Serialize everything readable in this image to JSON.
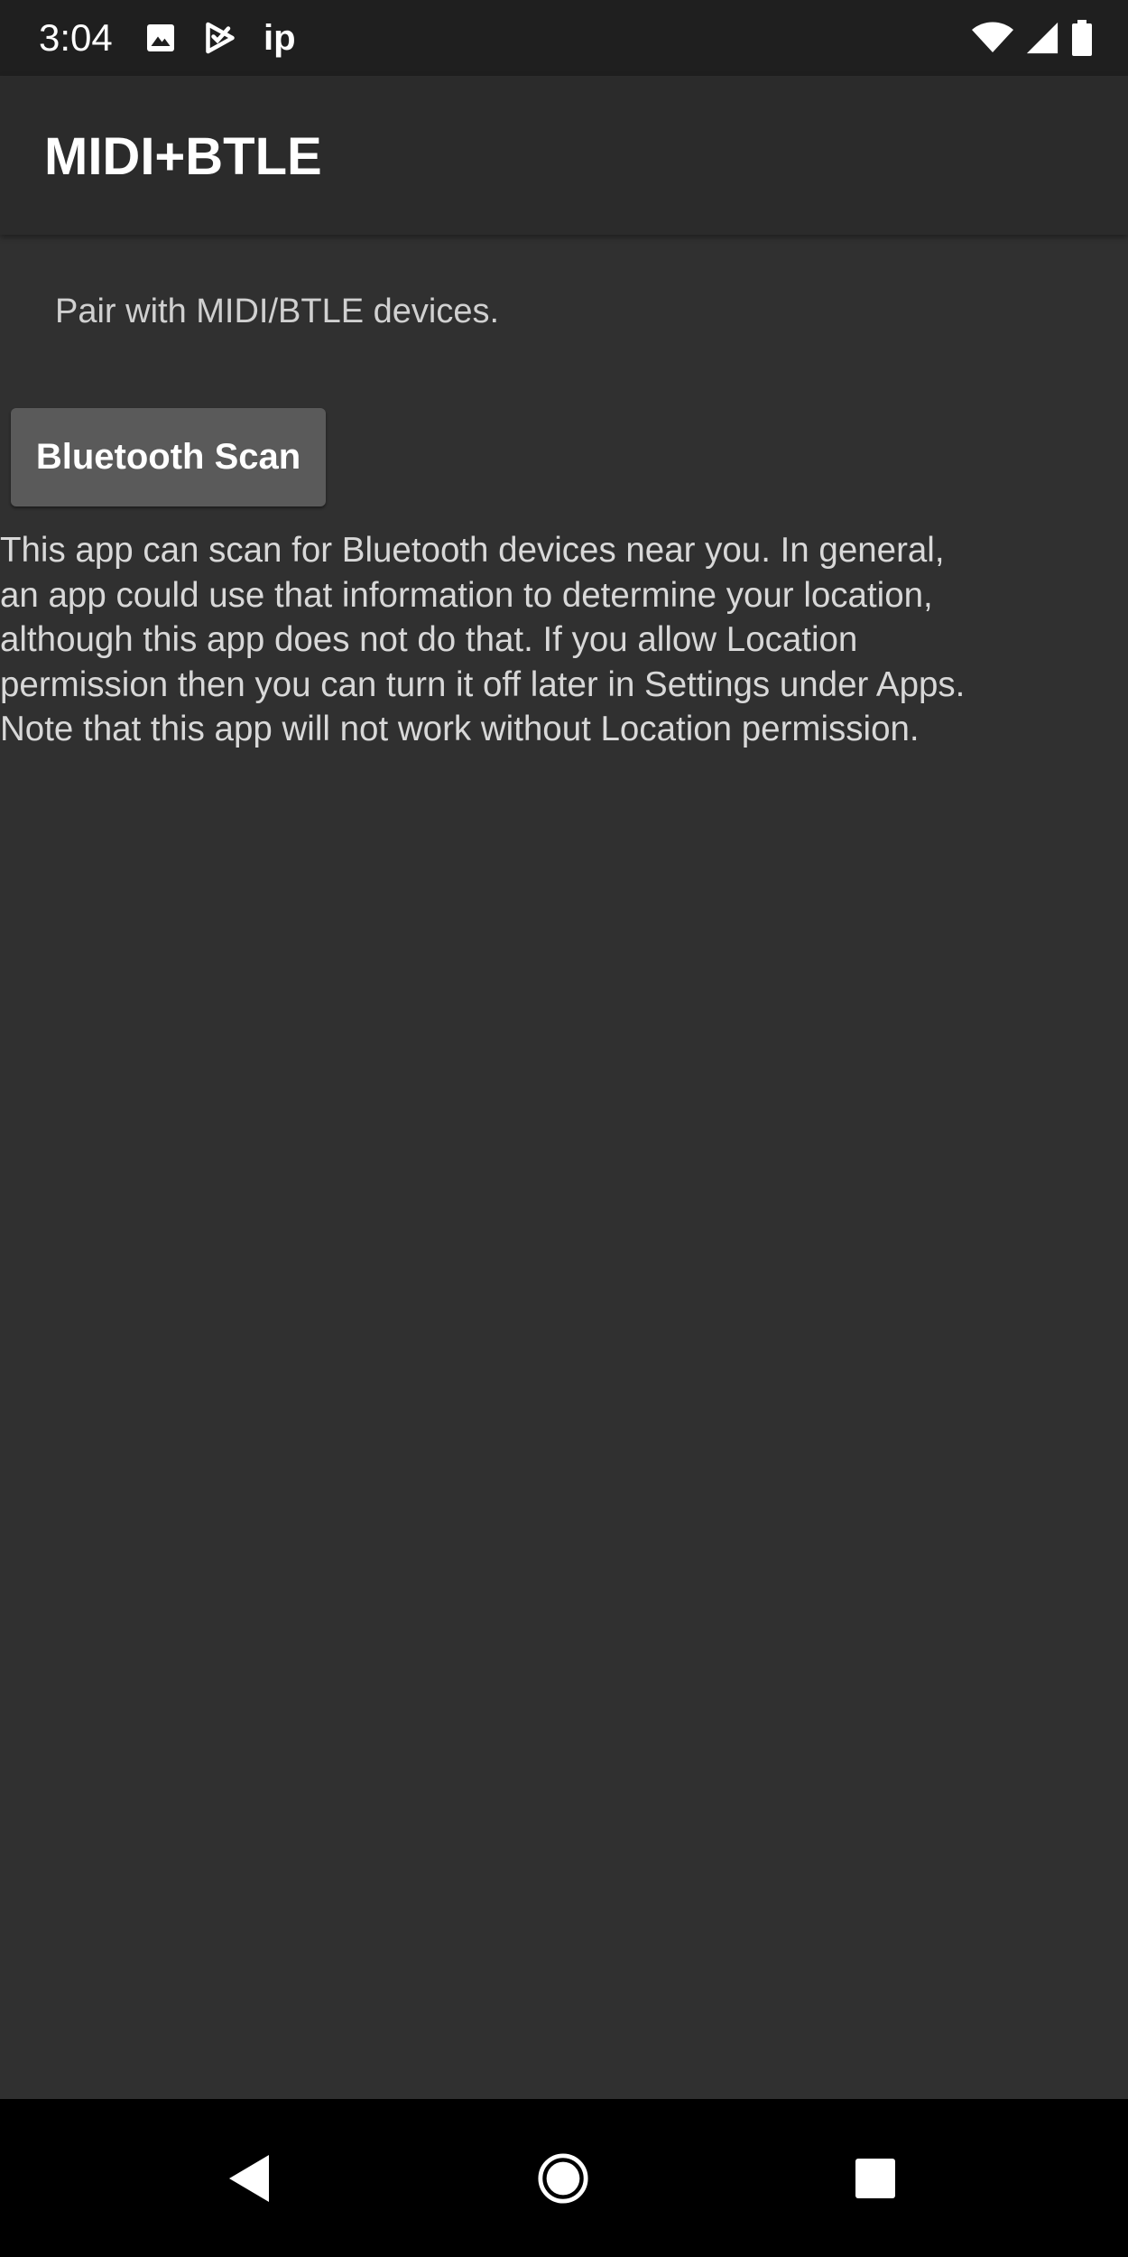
{
  "status_bar": {
    "time": "3:04",
    "notification_icons": [
      "image-icon",
      "play-check-icon"
    ],
    "ip_label": "ip",
    "right_icons": [
      "wifi-icon",
      "cell-signal-icon",
      "battery-icon"
    ]
  },
  "app_bar": {
    "title": "MIDI+BTLE"
  },
  "main": {
    "subtitle": "Pair with MIDI/BTLE devices.",
    "scan_button_label": "Bluetooth Scan",
    "info_lines": [
      "This app can scan for Bluetooth devices near you. In general,",
      "an app could use that information to determine your location,",
      "although this app does not do that. If you allow Location",
      "permission then you can turn it off later in Settings under Apps.",
      "Note that this app will not work without Location permission."
    ]
  },
  "nav_bar": {
    "buttons": [
      "back-icon",
      "home-icon",
      "recents-icon"
    ]
  },
  "colors": {
    "background": "#303030",
    "status_bar": "#1f1f1f",
    "app_bar": "#2b2b2b",
    "button": "#5a5a5a",
    "nav_bar": "#000000"
  }
}
